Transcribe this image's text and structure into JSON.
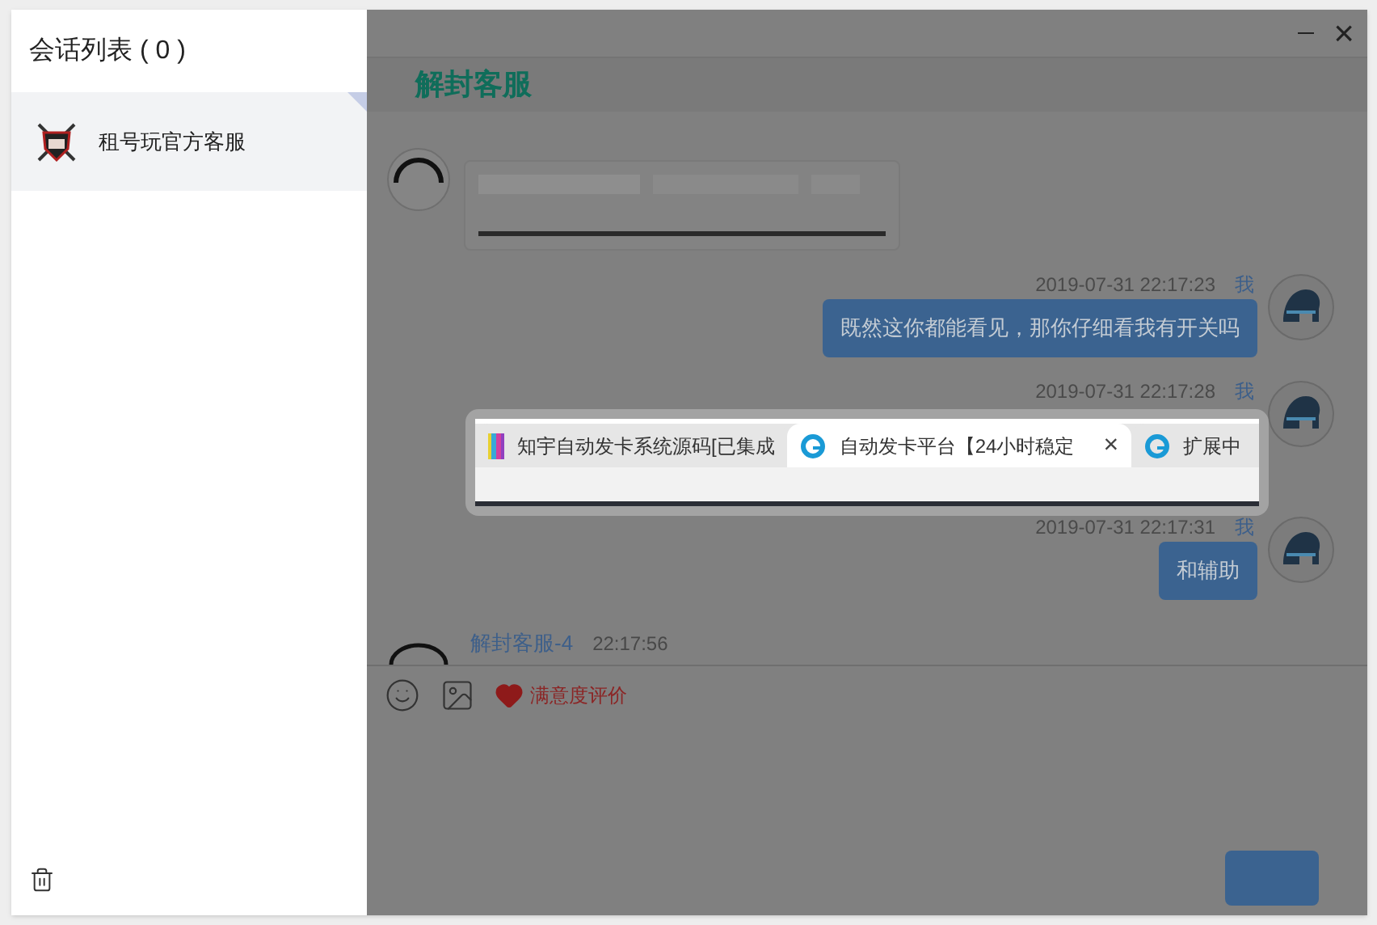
{
  "sidebar": {
    "title": "会话列表 ( 0 )",
    "items": [
      {
        "name": "租号玩官方客服",
        "selected": true
      }
    ]
  },
  "window": {
    "close": "×"
  },
  "chat": {
    "title": "解封客服",
    "messages": [
      {
        "kind": "agent_image"
      },
      {
        "kind": "user",
        "time": "2019-07-31 22:17:23",
        "sender": "我",
        "text": "既然这你都能看见，那你仔细看我有开关吗"
      },
      {
        "kind": "user",
        "time": "2019-07-31 22:17:28",
        "sender": "我"
      },
      {
        "kind": "user",
        "time": "2019-07-31 22:17:31",
        "sender": "我",
        "text": "和辅助"
      },
      {
        "kind": "agent_header",
        "sender": "解封客服-4",
        "time": "22:17:56"
      }
    ]
  },
  "preview": {
    "tabs": [
      {
        "title": "知宇自动发卡系统源码[已集成",
        "selected": false
      },
      {
        "title": "自动发卡平台【24小时稳定",
        "selected": true,
        "close": "×"
      },
      {
        "title": "扩展中",
        "selected": false
      }
    ]
  },
  "toolbar": {
    "rating": "满意度评价"
  }
}
